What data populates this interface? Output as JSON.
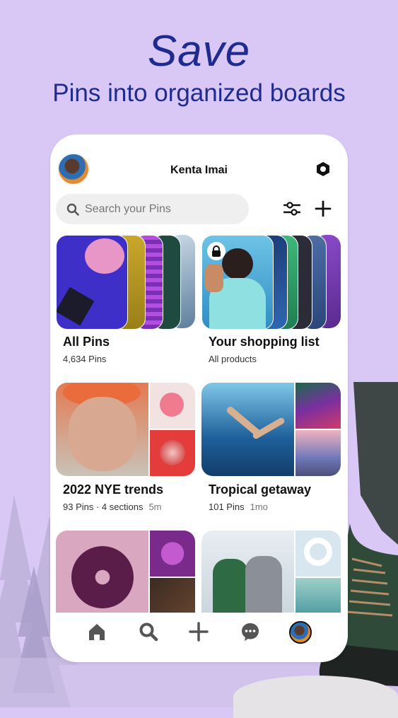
{
  "headline": {
    "title": "Save",
    "subtitle": "Pins into organized boards"
  },
  "profile": {
    "name": "Kenta Imai"
  },
  "search": {
    "placeholder": "Search your Pins"
  },
  "boards": [
    {
      "title": "All Pins",
      "meta": "4,634 Pins",
      "age": ""
    },
    {
      "title": "Your shopping list",
      "meta": "All products",
      "age": ""
    },
    {
      "title": "2022 NYE trends",
      "meta": "93 Pins · 4 sections",
      "age": "5m"
    },
    {
      "title": "Tropical getaway",
      "meta": "101 Pins",
      "age": "1mo"
    }
  ],
  "nav": {
    "items": [
      "home-icon",
      "search-icon",
      "plus-icon",
      "chat-icon",
      "profile-avatar"
    ]
  },
  "colors": {
    "background": "#d9c8f5",
    "headline": "#1f2b8f",
    "card": "#ffffff"
  }
}
